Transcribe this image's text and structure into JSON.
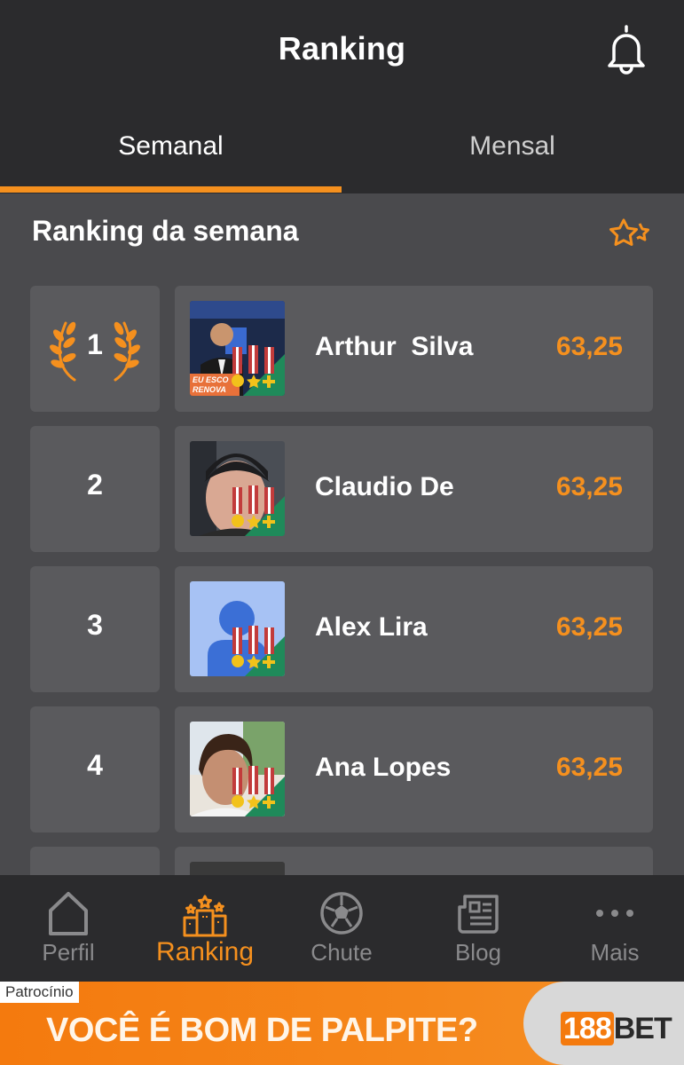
{
  "header": {
    "title": "Ranking"
  },
  "tabs": [
    {
      "label": "Semanal",
      "active": true
    },
    {
      "label": "Mensal",
      "active": false
    }
  ],
  "section": {
    "title": "Ranking da semana"
  },
  "ranking": [
    {
      "position": "1",
      "name": "Arthur  Silva",
      "score": "63,25",
      "avatar": "photo-man-suit-icon",
      "avatar_overlay_text": "EU ESCO\nRENOVA"
    },
    {
      "position": "2",
      "name": "Claudio De",
      "score": "63,25",
      "avatar": "photo-man-beanie-icon"
    },
    {
      "position": "3",
      "name": "Alex Lira",
      "score": "63,25",
      "avatar": "default-user-icon"
    },
    {
      "position": "4",
      "name": "Ana Lopes",
      "score": "63,25",
      "avatar": "photo-woman-icon"
    }
  ],
  "nav": [
    {
      "label": "Perfil",
      "icon": "home-icon",
      "active": false
    },
    {
      "label": "Ranking",
      "icon": "podium-icon",
      "active": true
    },
    {
      "label": "Chute",
      "icon": "soccer-ball-icon",
      "active": false
    },
    {
      "label": "Blog",
      "icon": "newspaper-icon",
      "active": false
    },
    {
      "label": "Mais",
      "icon": "more-dots-icon",
      "active": false
    }
  ],
  "ad": {
    "tag": "Patrocínio",
    "headline": "VOCÊ É BOM DE PALPITE?",
    "brand_num": "188",
    "brand_text": "BET"
  },
  "colors": {
    "accent": "#f5901e",
    "background": "#4a4a4d",
    "card": "#5a5a5d",
    "bar": "#2b2b2d"
  }
}
